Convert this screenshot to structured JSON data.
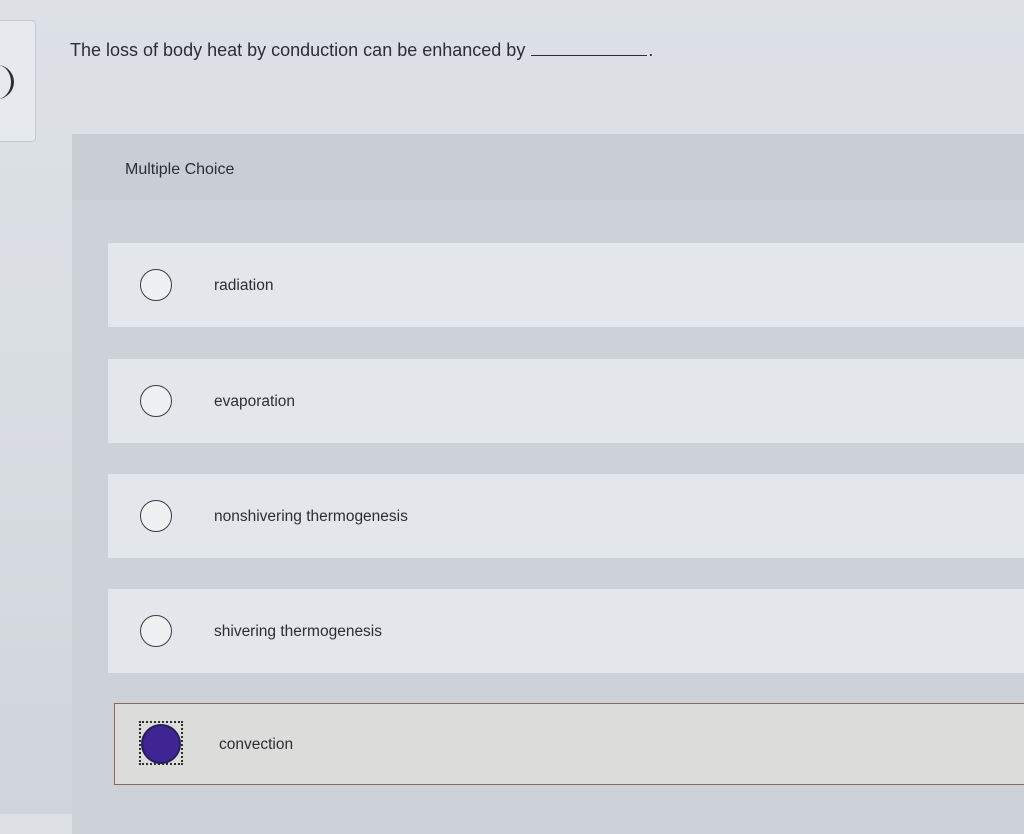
{
  "question": {
    "text": "The loss of body heat by conduction can be enhanced by",
    "period": "."
  },
  "mc": {
    "label": "Multiple Choice"
  },
  "options": [
    {
      "label": "radiation",
      "selected": false
    },
    {
      "label": "evaporation",
      "selected": false
    },
    {
      "label": "nonshivering thermogenesis",
      "selected": false
    },
    {
      "label": "shivering thermogenesis",
      "selected": false
    },
    {
      "label": "convection",
      "selected": true
    }
  ],
  "colors": {
    "selected_radio": "#3f2494",
    "selected_border": "#8a6a58"
  }
}
